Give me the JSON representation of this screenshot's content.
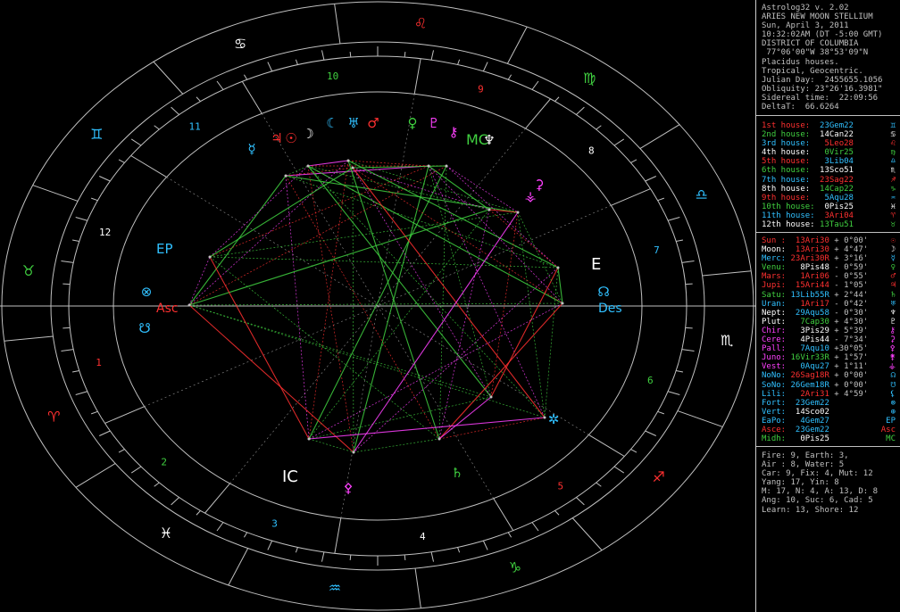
{
  "header_lines": [
    "Astrolog32 v. 2.02",
    "ARIES NEW MOON STELLIUM",
    "Sun, April 3, 2011",
    "10:32:02AM (DT -5:00 GMT)",
    "DISTRICT OF COLUMBIA",
    " 77°06'00\"W 38°53'09\"N",
    "Placidus houses.",
    "Tropical, Geocentric.",
    "Julian Day:  2455655.1056",
    "Obliquity: 23°26'16.3981\"",
    "Sidereal time:  22:09:56",
    "DeltaT:  66.6264"
  ],
  "houses": [
    {
      "label": "1st house:",
      "value": "23Gem22",
      "color": "#ff3030",
      "vcolor": "#30c0ff",
      "sym": "♊"
    },
    {
      "label": "2nd house:",
      "value": "14Can22",
      "color": "#40d040",
      "vcolor": "#ffffff",
      "sym": "♋"
    },
    {
      "label": "3rd house:",
      "value": "5Leo28",
      "color": "#30c0ff",
      "vcolor": "#ff3030",
      "sym": "♌"
    },
    {
      "label": "4th house:",
      "value": "0Vir25",
      "color": "#ffffff",
      "vcolor": "#40d040",
      "sym": "♍"
    },
    {
      "label": "5th house:",
      "value": "3Lib04",
      "color": "#ff3030",
      "vcolor": "#30c0ff",
      "sym": "♎"
    },
    {
      "label": "6th house:",
      "value": "13Sco51",
      "color": "#40d040",
      "vcolor": "#ffffff",
      "sym": "♏"
    },
    {
      "label": "7th house:",
      "value": "23Sag22",
      "color": "#30c0ff",
      "vcolor": "#ff3030",
      "sym": "♐"
    },
    {
      "label": "8th house:",
      "value": "14Cap22",
      "color": "#ffffff",
      "vcolor": "#40d040",
      "sym": "♑"
    },
    {
      "label": "9th house:",
      "value": "5Aqu28",
      "color": "#ff3030",
      "vcolor": "#30c0ff",
      "sym": "♒"
    },
    {
      "label": "10th house:",
      "value": "0Pis25",
      "color": "#40d040",
      "vcolor": "#ffffff",
      "sym": "♓"
    },
    {
      "label": "11th house:",
      "value": "3Ari04",
      "color": "#30c0ff",
      "vcolor": "#ff3030",
      "sym": "♈"
    },
    {
      "label": "12th house:",
      "value": "13Tau51",
      "color": "#ffffff",
      "vcolor": "#40d040",
      "sym": "♉"
    }
  ],
  "planets": [
    {
      "name": "Sun :",
      "pos": "13Ari30",
      "speed": "+ 0°00'",
      "ncolor": "#ff3030",
      "pcolor": "#ff3030",
      "sym": "☉"
    },
    {
      "name": "Moon:",
      "pos": "13Ari30",
      "speed": "+ 4°47'",
      "ncolor": "#ffffff",
      "pcolor": "#ff3030",
      "sym": "☽"
    },
    {
      "name": "Merc:",
      "pos": "23Ari30R",
      "speed": "+ 3°16'",
      "ncolor": "#30c0ff",
      "pcolor": "#ff3030",
      "sym": "☿"
    },
    {
      "name": "Venu:",
      "pos": "8Pis48",
      "speed": "- 0°59'",
      "ncolor": "#40d040",
      "pcolor": "#ffffff",
      "sym": "♀"
    },
    {
      "name": "Mars:",
      "pos": "1Ari06",
      "speed": "- 0°55'",
      "ncolor": "#ff3030",
      "pcolor": "#ff3030",
      "sym": "♂"
    },
    {
      "name": "Jupi:",
      "pos": "15Ari44",
      "speed": "- 1°05'",
      "ncolor": "#ff3030",
      "pcolor": "#ff3030",
      "sym": "♃"
    },
    {
      "name": "Satu:",
      "pos": "13Lib55R",
      "speed": "+ 2°44'",
      "ncolor": "#40d040",
      "pcolor": "#30c0ff",
      "sym": "♄"
    },
    {
      "name": "Uran:",
      "pos": "1Ari17",
      "speed": "- 0°42'",
      "ncolor": "#30c0ff",
      "pcolor": "#ff3030",
      "sym": "♅"
    },
    {
      "name": "Nept:",
      "pos": "29Aqu58",
      "speed": "- 0°30'",
      "ncolor": "#ffffff",
      "pcolor": "#30c0ff",
      "sym": "♆"
    },
    {
      "name": "Plut:",
      "pos": "7Cap30",
      "speed": "+ 4°30'",
      "ncolor": "#ffffff",
      "pcolor": "#40d040",
      "sym": "♇"
    },
    {
      "name": "Chir:",
      "pos": "3Pis29",
      "speed": "+ 5°39'",
      "ncolor": "#ff40ff",
      "pcolor": "#ffffff",
      "sym": "⚷"
    },
    {
      "name": "Cere:",
      "pos": "4Pis44",
      "speed": "- 7°34'",
      "ncolor": "#ff40ff",
      "pcolor": "#ffffff",
      "sym": "⚳"
    },
    {
      "name": "Pall:",
      "pos": "7Aqu10",
      "speed": "+30°05'",
      "ncolor": "#ff40ff",
      "pcolor": "#30c0ff",
      "sym": "⚴"
    },
    {
      "name": "Juno:",
      "pos": "16Vir33R",
      "speed": "+ 1°57'",
      "ncolor": "#ff40ff",
      "pcolor": "#40d040",
      "sym": "⚵"
    },
    {
      "name": "Vest:",
      "pos": "0Aqu27",
      "speed": "+ 1°11'",
      "ncolor": "#ff40ff",
      "pcolor": "#30c0ff",
      "sym": "⚶"
    },
    {
      "name": "NoNo:",
      "pos": "26Sag18R",
      "speed": "+ 0°00'",
      "ncolor": "#30c0ff",
      "pcolor": "#ff3030",
      "sym": "☊"
    },
    {
      "name": "SoNo:",
      "pos": "26Gem18R",
      "speed": "+ 0°00'",
      "ncolor": "#30c0ff",
      "pcolor": "#30c0ff",
      "sym": "☋"
    },
    {
      "name": "Lili:",
      "pos": "2Ari31",
      "speed": "+ 4°59'",
      "ncolor": "#30c0ff",
      "pcolor": "#ff3030",
      "sym": "⚸"
    },
    {
      "name": "Fort:",
      "pos": "23Gem22",
      "speed": "",
      "ncolor": "#30c0ff",
      "pcolor": "#30c0ff",
      "sym": "⊗"
    },
    {
      "name": "Vert:",
      "pos": "14Sco02",
      "speed": "",
      "ncolor": "#30c0ff",
      "pcolor": "#ffffff",
      "sym": "⊕"
    },
    {
      "name": "EaPo:",
      "pos": "4Gem27",
      "speed": "",
      "ncolor": "#30c0ff",
      "pcolor": "#30c0ff",
      "sym": "EP"
    },
    {
      "name": "Asce:",
      "pos": "23Gem22",
      "speed": "",
      "ncolor": "#ff3030",
      "pcolor": "#30c0ff",
      "sym": "Asc"
    },
    {
      "name": "Midh:",
      "pos": "0Pis25",
      "speed": "",
      "ncolor": "#40d040",
      "pcolor": "#ffffff",
      "sym": "MC"
    }
  ],
  "stats_lines": [
    "Fire: 9, Earth: 3,",
    "Air : 8, Water: 5",
    "Car: 9, Fix: 4, Mut: 12",
    "Yang: 17, Yin: 8",
    "M: 17, N: 4, A: 13, D: 8",
    "Ang: 10, Suc: 6, Cad: 5",
    "Learn: 13, Shore: 12"
  ],
  "chart_data": {
    "type": "astrological-wheel",
    "house_numbers": [
      "1",
      "2",
      "3",
      "4",
      "5",
      "6",
      "7",
      "8",
      "9",
      "10",
      "11",
      "12"
    ],
    "sign_glyphs": [
      "♈",
      "♉",
      "♊",
      "♋",
      "♌",
      "♍",
      "♎",
      "♏",
      "♐",
      "♑",
      "♒",
      "♓"
    ],
    "angle_labels": {
      "asc": "Asc",
      "des": "Des",
      "ic": "IC",
      "mc": "MC"
    },
    "point_labels": {
      "ep": "EP",
      "lilith": "E"
    },
    "colors": {
      "fire": "#ff3030",
      "earth": "#40d040",
      "air": "#30c0ff",
      "water": "#ffffff",
      "aspect_yellow": "#ffff40",
      "aspect_magenta": "#ff40ff"
    }
  }
}
